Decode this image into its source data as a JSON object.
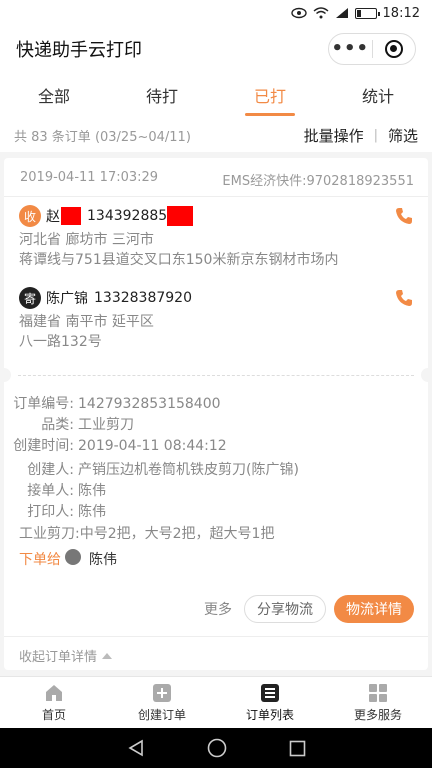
{
  "status_bar": {
    "time": "18:12"
  },
  "app": {
    "title": "快递助手云打印"
  },
  "tabs": [
    {
      "label": "全部",
      "active": false
    },
    {
      "label": "待打",
      "active": false
    },
    {
      "label": "已打",
      "active": true
    },
    {
      "label": "统计",
      "active": false
    }
  ],
  "summary": {
    "count_text": "共 83 条订单 (03/25~04/11)",
    "batch_label": "批量操作",
    "filter_label": "筛选"
  },
  "order": {
    "datetime": "2019-04-11 17:03:29",
    "tracking": "EMS经济快件:9702818923551",
    "receiver": {
      "badge": "收",
      "name": "赵",
      "phone": "134392885",
      "address_line1": "河北省 廊坊市 三河市",
      "address_line2": "蒋谭线与751县道交叉口东150米新京东钢材市场内"
    },
    "sender": {
      "badge": "寄",
      "name": "陈广锦",
      "phone": "13328387920",
      "address_line1": "福建省 南平市 延平区",
      "address_line2": "八一路132号"
    },
    "details": [
      {
        "label": "订单编号:",
        "value": "1427932853158400"
      },
      {
        "label": "品类:",
        "value": "工业剪刀"
      },
      {
        "label": "创建时间:",
        "value": "2019-04-11 08:44:12"
      }
    ],
    "people": [
      {
        "label": "创建人:",
        "value": "产销压边机卷筒机铁皮剪刀(陈广锦)"
      },
      {
        "label": "接单人:",
        "value": "陈伟"
      },
      {
        "label": "打印人:",
        "value": "陈伟"
      }
    ],
    "note": "工业剪刀:中号2把，大号2把，超大号1把",
    "assign_label": "下单给",
    "assign_to": "陈伟",
    "more_label": "更多",
    "share_label": "分享物流",
    "detail_label": "物流详情",
    "collapse_label": "收起订单详情"
  },
  "bottom_nav": [
    {
      "label": "首页",
      "icon": "home-icon"
    },
    {
      "label": "创建订单",
      "icon": "plus-square-icon"
    },
    {
      "label": "订单列表",
      "icon": "list-icon"
    },
    {
      "label": "更多服务",
      "icon": "grid-icon"
    }
  ],
  "colors": {
    "accent": "#f28a45",
    "redaction": "#ff0000"
  }
}
